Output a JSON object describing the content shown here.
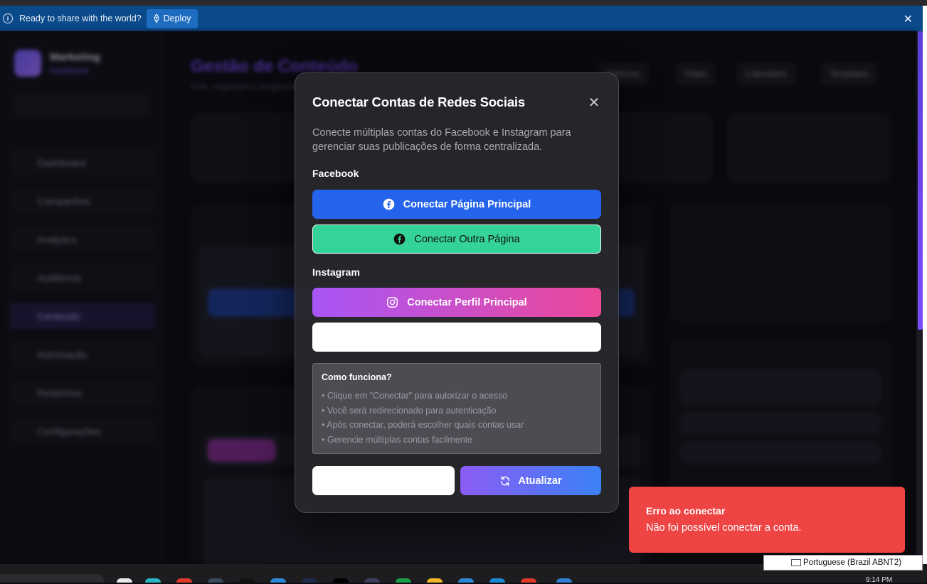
{
  "banner": {
    "text": "Ready to share with the world?",
    "deploy_label": "Deploy",
    "close_glyph": "✕",
    "info_glyph": "i"
  },
  "background_app": {
    "brand": "Marketing",
    "brand_sub": "Dashboard",
    "page_title": "Gestão de Conteúdo",
    "page_subtitle": "Crie, organize e programe seu conteúdo de marketing",
    "toolbar": [
      "Métricas",
      "Vídeo",
      "Calendário",
      "Templates"
    ],
    "sidebar": [
      "Dashboard",
      "Campanhas",
      "Analytics",
      "Audiência",
      "Conteúdo",
      "Automação",
      "Relatórios",
      "Configurações"
    ]
  },
  "modal": {
    "title": "Conectar Contas de Redes Sociais",
    "close_glyph": "✕",
    "description": "Conecte múltiplas contas do Facebook e Instagram para gerenciar suas publicações de forma centralizada.",
    "facebook_heading": "Facebook",
    "facebook_main_label": "Conectar Página Principal",
    "facebook_other_label": "Conectar Outra Página",
    "instagram_heading": "Instagram",
    "instagram_main_label": "Conectar Perfil Principal",
    "instagram_other_label": "",
    "how": {
      "title": "Como funciona?",
      "items": [
        "• Clique em \"Conectar\" para autorizar o acesso",
        "• Você será redirecionado para autenticação",
        "• Após conectar, poderá escolher quais contas usar",
        "• Gerencie múltiplas contas facilmente"
      ]
    },
    "cancel_label": "",
    "refresh_label": "Atualizar"
  },
  "toast": {
    "title": "Erro ao conectar",
    "description": "Não foi possível conectar a conta."
  },
  "taskbar": {
    "language": "Portuguese (Brazil ABNT2)",
    "time": "9:14 PM"
  },
  "colors": {
    "facebook_blue": "#2463eb",
    "facebook_green": "#34d399",
    "instagram_gradient_start": "#a855f7",
    "instagram_gradient_end": "#ec4899",
    "refresh_gradient_start": "#8b5cf6",
    "refresh_gradient_end": "#3b82f6",
    "toast_red": "#ef4444",
    "banner_blue": "#0a4a8a"
  }
}
